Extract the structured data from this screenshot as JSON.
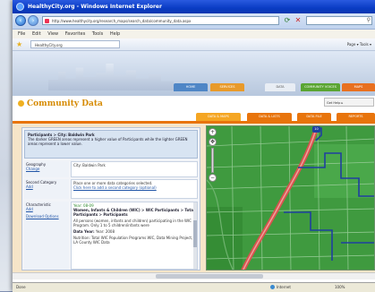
{
  "window": {
    "title": "HealthyCity.org - Windows Internet Explorer"
  },
  "toolbar": {
    "url": "http://www.healthycity.org/research_maps/search_data/community_data.aspx",
    "fav_tab": "HealthyCity.org",
    "menu": [
      "File",
      "Edit",
      "View",
      "Favorites",
      "Tools",
      "Help"
    ],
    "commands": "Page ▾  Tools ▾"
  },
  "site": {
    "nav": [
      "HOME",
      "SERVICES",
      "DATA",
      "COMMUNITY VOICES",
      "MAPS"
    ],
    "page_title": "Community Data",
    "help_label": "Get Help ▸",
    "tabs": [
      "DATA & MAPS",
      "DATA & LISTS",
      "DATA FILE",
      "REPORTS"
    ]
  },
  "panel": {
    "header_title": "Participants > City: Baldwin Park",
    "header_text": "The darker GREEN areas represent a higher value of Participants while the lighter GREEN areas represent a lower value.",
    "rows": [
      {
        "label": "Geography",
        "link": "Change",
        "value": "City: Baldwin Park"
      },
      {
        "label": "Second Category",
        "link": "Add",
        "value": "Place one or more data categories selected.",
        "value_link": "Click here to add a second category (optional)"
      },
      {
        "label": "Characteristic",
        "link": "Add",
        "link2": "Download Options",
        "count": "Year: 08-09",
        "value_title": "Women, Infants & Children (WIC) > WIC Participants > Total Participants > Participants",
        "value_text": "All persons (women, infants and children) participating in the WIC Program. Only 1 to 5 children/infants were",
        "source_label": "Data Year:",
        "source_year": "Year: 2008",
        "source_note": "Nutrition: Total WIC Population Programs WIC, Data Mining Project, LA County WIC Data"
      }
    ]
  },
  "map": {
    "highway_label": "10"
  },
  "status": {
    "text": "Done",
    "zone": "Internet",
    "zoom": "100%"
  },
  "colors": {
    "map_green": "#3f9a3f",
    "road_red": "#d9534f",
    "boundary_blue": "#1f3f9f",
    "accent_orange": "#e8740c"
  }
}
